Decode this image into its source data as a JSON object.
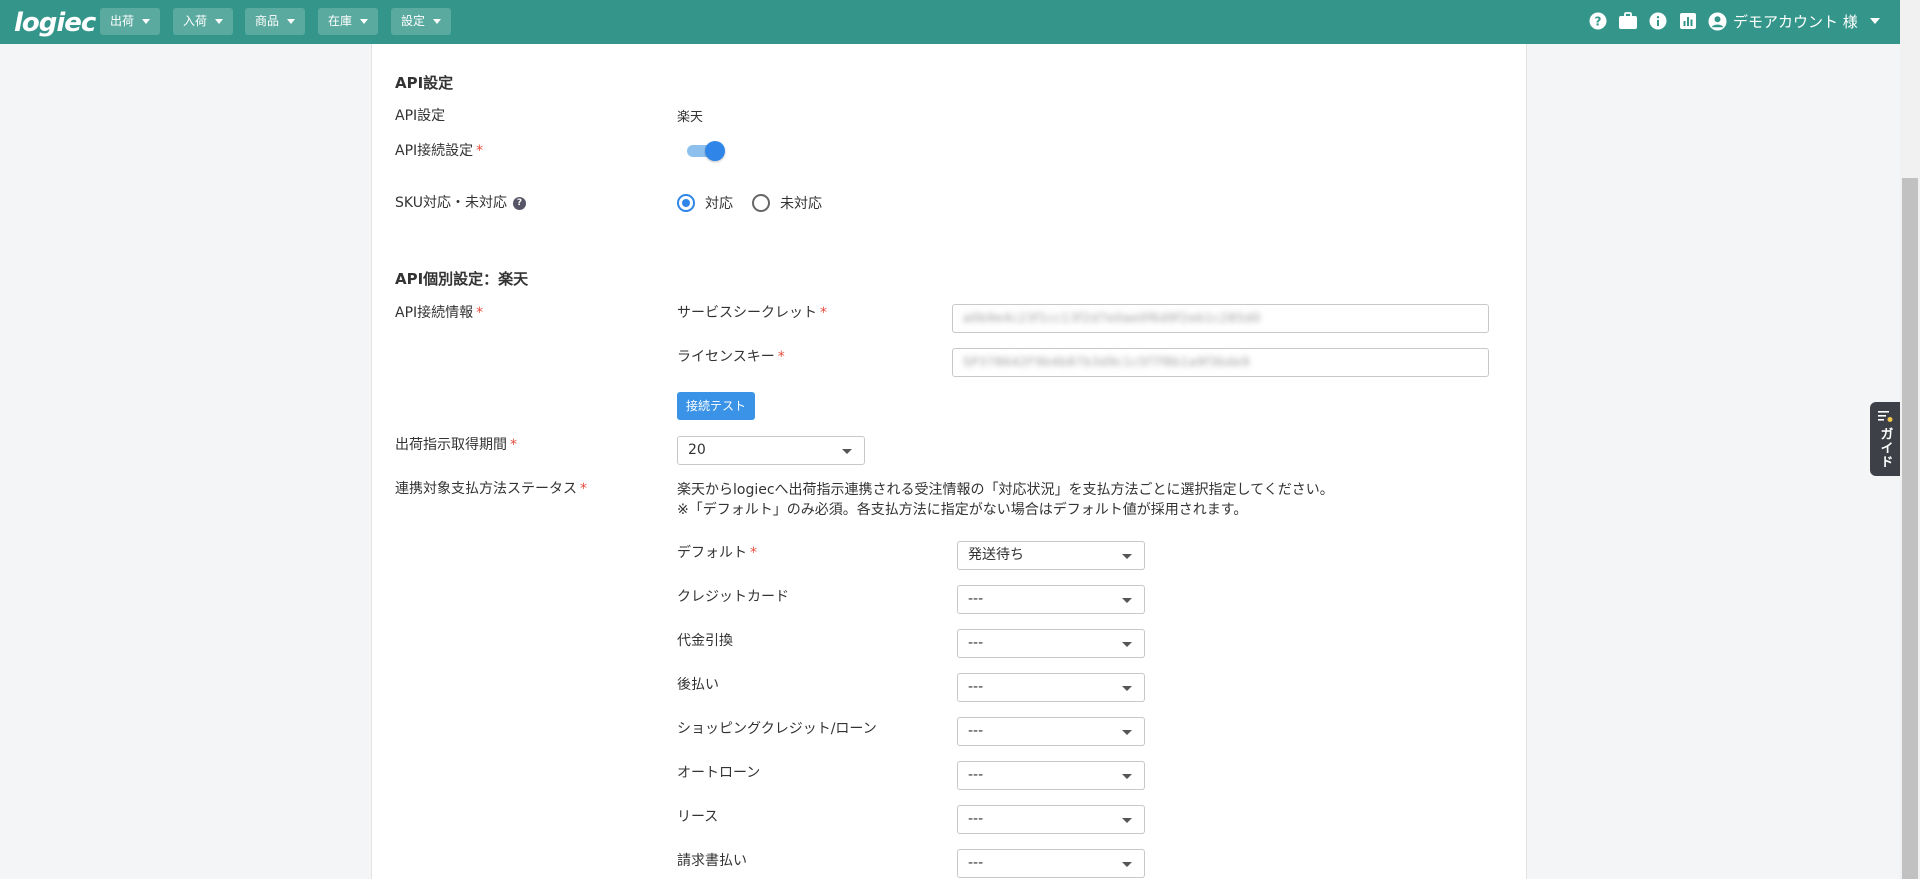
{
  "brand": {
    "logo": "logiec"
  },
  "nav": {
    "items": [
      {
        "label": "出荷"
      },
      {
        "label": "入荷"
      },
      {
        "label": "商品"
      },
      {
        "label": "在庫"
      },
      {
        "label": "設定"
      }
    ]
  },
  "header_icons": [
    "help-circle-icon",
    "briefcase-icon",
    "info-icon",
    "bar-chart-icon"
  ],
  "account": {
    "name": "デモアカウント 様"
  },
  "api_settings": {
    "section_title": "API設定",
    "api_setting_label": "API設定",
    "api_setting_value": "楽天",
    "api_connection_label": "API接続設定",
    "api_connection_enabled": true,
    "sku_label": "SKU対応・未対応",
    "sku_options": [
      "対応",
      "未対応"
    ],
    "sku_selected": "対応"
  },
  "api_individual": {
    "section_title": "API個別設定：楽天",
    "connection_info_label": "API接続情報",
    "service_secret_label": "サービスシークレット",
    "service_secret_value": "a0b9e4c23f1cc13f2d7e0ae0f6d9f2eb1c285d0",
    "license_key_label": "ライセンスキー",
    "license_key_value": "SP378642F9b4b87b3d9c1c5f7f8b1a9f3bde9",
    "test_button": "接続テスト",
    "period_label": "出荷指示取得期間",
    "period_value": "20",
    "payment_status_label": "連携対象支払方法ステータス",
    "payment_desc_line1": "楽天からlogiecへ出荷指示連携される受注情報の「対応状況」を支払方法ごとに選択指定してください。",
    "payment_desc_line2": "※「デフォルト」のみ必須。各支払方法に指定がない場合はデフォルト値が採用されます。",
    "payment_methods": [
      {
        "label": "デフォルト",
        "required": "*",
        "value": "発送待ち"
      },
      {
        "label": "クレジットカード",
        "required": "",
        "value": "---"
      },
      {
        "label": "代金引換",
        "required": "",
        "value": "---"
      },
      {
        "label": "後払い",
        "required": "",
        "value": "---"
      },
      {
        "label": "ショッピングクレジット/ローン",
        "required": "",
        "value": "---"
      },
      {
        "label": "オートローン",
        "required": "",
        "value": "---"
      },
      {
        "label": "リース",
        "required": "",
        "value": "---"
      },
      {
        "label": "請求書払い",
        "required": "",
        "value": "---"
      }
    ]
  },
  "guide": {
    "label": "ガイド"
  },
  "required_mark": "*",
  "colors": {
    "header": "#34968a",
    "nav_button": "#5aaa9f",
    "primary": "#3a93e6",
    "required": "#e74c3c"
  }
}
